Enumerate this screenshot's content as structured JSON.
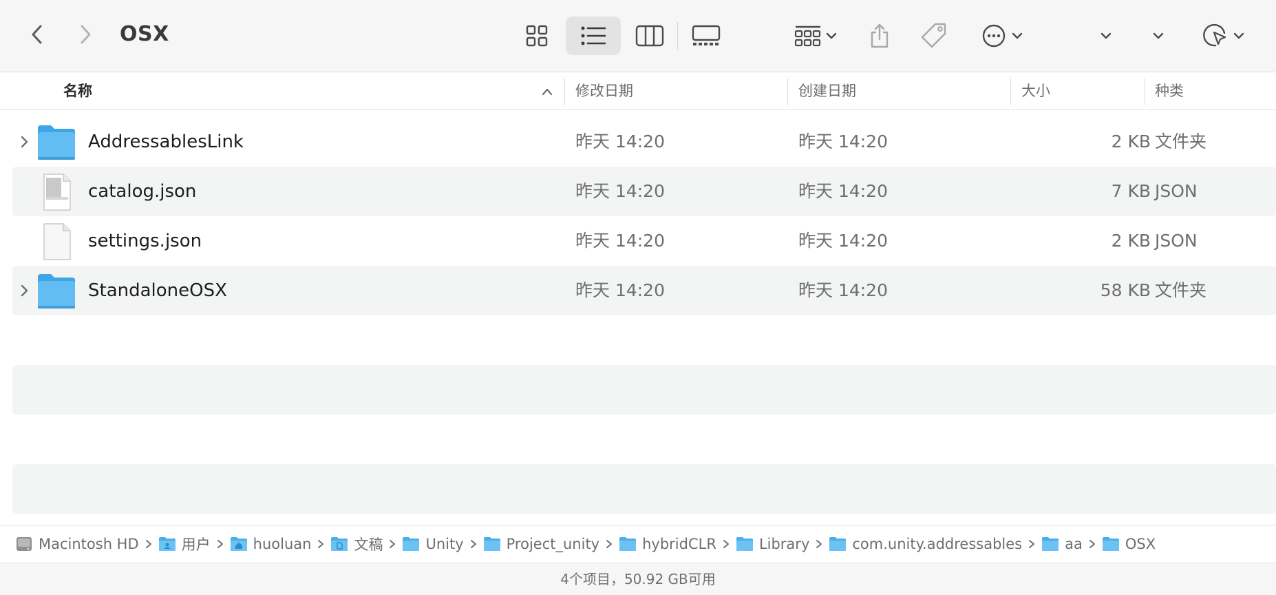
{
  "window": {
    "title": "OSX"
  },
  "toolbar": {
    "back_icon": "chevron-left-icon",
    "forward_icon": "chevron-right-icon",
    "view_modes": [
      {
        "name": "icon-view",
        "icon": "grid-icon",
        "selected": false
      },
      {
        "name": "list-view",
        "icon": "list-icon",
        "selected": true
      },
      {
        "name": "column-view",
        "icon": "columns-icon",
        "selected": false
      },
      {
        "name": "gallery-view",
        "icon": "gallery-icon",
        "selected": false
      }
    ],
    "actions": [
      "group-icon",
      "share-icon",
      "tag-icon",
      "more-icon",
      "dropdown-icon",
      "dropdown-icon",
      "markup-icon"
    ]
  },
  "columns": {
    "name": "名称",
    "modified": "修改日期",
    "created": "创建日期",
    "size": "大小",
    "kind": "种类"
  },
  "files": [
    {
      "name": "AddressablesLink",
      "modified": "昨天 14:20",
      "created": "昨天 14:20",
      "size": "2 KB",
      "kind": "文件夹",
      "type": "folder"
    },
    {
      "name": "catalog.json",
      "modified": "昨天 14:20",
      "created": "昨天 14:20",
      "size": "7 KB",
      "kind": "JSON",
      "type": "json-doc"
    },
    {
      "name": "settings.json",
      "modified": "昨天 14:20",
      "created": "昨天 14:20",
      "size": "2 KB",
      "kind": "JSON",
      "type": "blank-doc"
    },
    {
      "name": "StandaloneOSX",
      "modified": "昨天 14:20",
      "created": "昨天 14:20",
      "size": "58 KB",
      "kind": "文件夹",
      "type": "folder"
    }
  ],
  "pathbar": [
    {
      "label": "Macintosh HD",
      "icon": "hard-disk-icon"
    },
    {
      "label": "用户",
      "icon": "users-folder-icon"
    },
    {
      "label": "huoluan",
      "icon": "home-folder-icon"
    },
    {
      "label": "文稿",
      "icon": "documents-folder-icon"
    },
    {
      "label": "Unity",
      "icon": "folder-icon"
    },
    {
      "label": "Project_unity",
      "icon": "folder-icon"
    },
    {
      "label": "hybridCLR",
      "icon": "folder-icon"
    },
    {
      "label": "Library",
      "icon": "folder-icon"
    },
    {
      "label": "com.unity.addressables",
      "icon": "folder-icon"
    },
    {
      "label": "aa",
      "icon": "folder-icon"
    },
    {
      "label": "OSX",
      "icon": "folder-icon"
    }
  ],
  "status": {
    "text": "4个项目，50.92 GB可用"
  },
  "colors": {
    "folder_blue": "#5ab6ef",
    "folder_tab": "#3ea6e6",
    "selected_view_bg": "#e3e3e3",
    "row_alt_bg": "#f3f4f4"
  }
}
